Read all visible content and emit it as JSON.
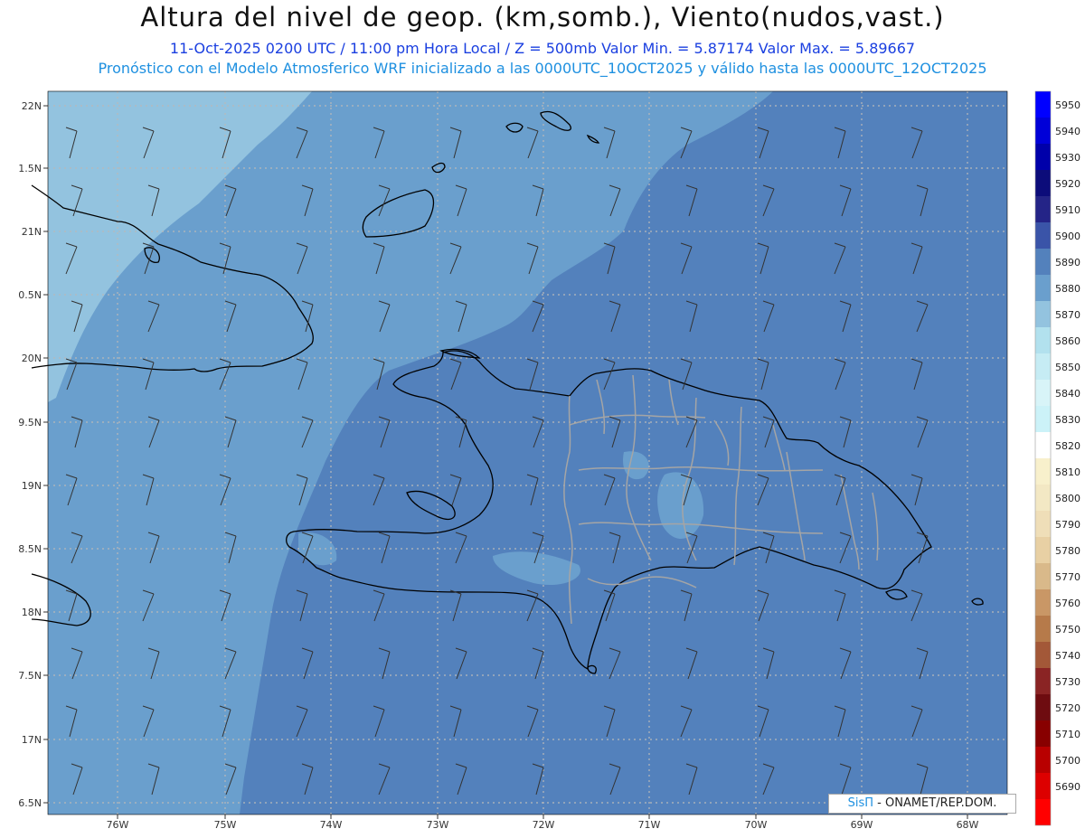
{
  "header": {
    "title": "Altura del nivel de geop. (km,somb.), Viento(nudos,vast.)",
    "subtitle1": "11-Oct-2025  0200 UTC / 11:00 pm Hora Local / Z = 500mb    Valor Min. = 5.87174   Valor Max. = 5.89667",
    "subtitle2": "Pronóstico con el Modelo Atmosferico WRF inicializado a las 0000UTC_10OCT2025 y válido hasta las  0000UTC_12OCT2025"
  },
  "map": {
    "lat_labels": [
      "22N",
      "1.5N",
      "21N",
      "0.5N",
      "20N",
      "9.5N",
      "19N",
      "8.5N",
      "18N",
      "7.5N",
      "17N",
      "6.5N"
    ],
    "lon_labels": [
      "76W",
      "75W",
      "74W",
      "73W",
      "72W",
      "71W",
      "70W",
      "69W",
      "68W"
    ],
    "colors": {
      "shade_5870": "#93c3df",
      "shade_5880": "#6a9fcd",
      "shade_5890": "#5381bc",
      "grid": "#b9b9b9",
      "coast": "#000000",
      "border": "#a5a5a5"
    }
  },
  "colorbar": {
    "labels": [
      "5950",
      "5940",
      "5930",
      "5920",
      "5910",
      "5900",
      "5890",
      "5880",
      "5870",
      "5860",
      "5850",
      "5840",
      "5830",
      "5820",
      "5810",
      "5800",
      "5790",
      "5780",
      "5770",
      "5760",
      "5750",
      "5740",
      "5730",
      "5720",
      "5710",
      "5700",
      "5690"
    ],
    "colors": [
      "#0000ff",
      "#0000d8",
      "#0000aa",
      "#0c0c7a",
      "#242487",
      "#3a54a8",
      "#5381bc",
      "#6a9fcd",
      "#93c3df",
      "#b2e1ee",
      "#c6ecf4",
      "#d8f4f8",
      "#ccf2f8",
      "#ffffff",
      "#f8f0cc",
      "#f3e8c4",
      "#efdeb8",
      "#e8d0a4",
      "#d9b98a",
      "#c99766",
      "#b67a4a",
      "#a35838",
      "#8a2424",
      "#6e0c10",
      "#880000",
      "#b80000",
      "#dd0000",
      "#ff0000"
    ]
  },
  "credit": {
    "brand": "SisΠ",
    "text": "- ONAMET/REP.DOM."
  }
}
